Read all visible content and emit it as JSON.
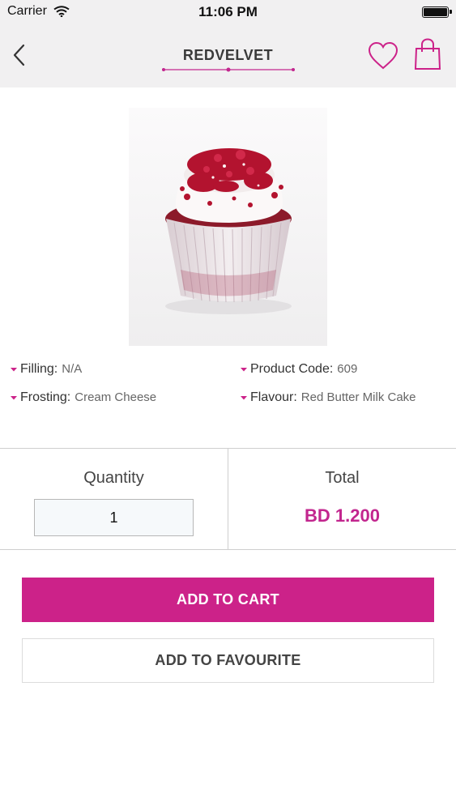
{
  "status_bar": {
    "carrier": "Carrier",
    "time": "11:06 PM"
  },
  "header": {
    "title": "REDVELVET",
    "back_icon": "chevron-left-icon",
    "favorite_icon": "heart-icon",
    "cart_icon": "shopping-bag-icon"
  },
  "product": {
    "image": "red-velvet-cupcake",
    "specs": [
      {
        "label": "Filling:",
        "value": "N/A"
      },
      {
        "label": "Product Code:",
        "value": "609"
      },
      {
        "label": "Frosting:",
        "value": "Cream Cheese"
      },
      {
        "label": "Flavour:",
        "value": "Red Butter Milk Cake"
      }
    ]
  },
  "order": {
    "quantity_label": "Quantity",
    "quantity_value": "1",
    "total_label": "Total",
    "total_value": "BD 1.200"
  },
  "actions": {
    "add_to_cart": "ADD TO CART",
    "add_to_favourite": "ADD TO FAVOURITE"
  },
  "colors": {
    "accent": "#cc2289",
    "price": "#c2268e",
    "header_bg": "#f1f0f1"
  }
}
